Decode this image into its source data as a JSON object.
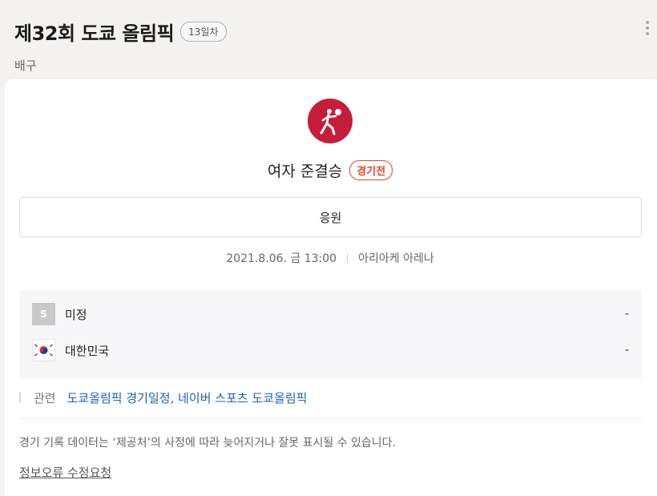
{
  "header": {
    "title": "제32회 도쿄 올림픽",
    "day_badge": "13일차",
    "subtitle": "배구"
  },
  "match": {
    "sport_icon": "volleyball-icon",
    "title": "여자 준결승",
    "status": "경기전",
    "cheer_label": "응원",
    "datetime": "2021.8.06. 금 13:00",
    "venue": "아리아케 아레나"
  },
  "teams": [
    {
      "badge": "S",
      "name": "미정",
      "score": "-"
    },
    {
      "flag": "korea-flag-icon",
      "name": "대한민국",
      "score": "-"
    }
  ],
  "related": {
    "label": "관련",
    "link": "도쿄올림픽 경기일정, 네이버 스포츠 도쿄올림픽"
  },
  "notice": "경기 기록 데이터는 ‘제공처’의 사정에 따라 늦어지거나 잘못 표시될 수 있습니다.",
  "report_link": "정보오류 수정요청",
  "colors": {
    "sport_icon_bg": "#c41e3a",
    "status_accent": "#e0462d",
    "link": "#1a63b8"
  }
}
